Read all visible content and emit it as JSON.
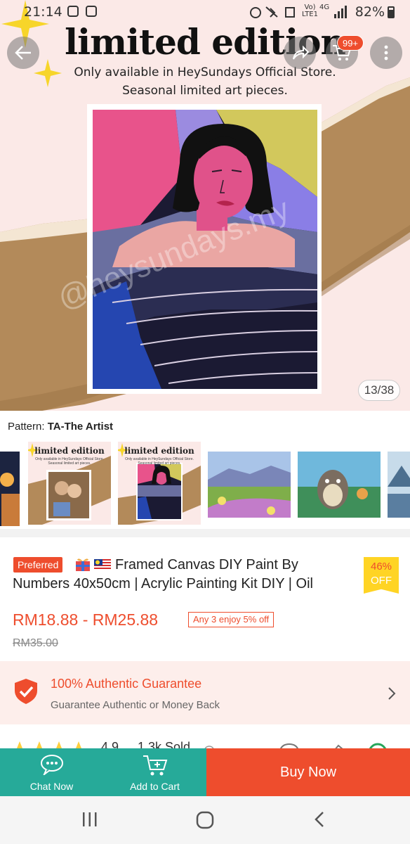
{
  "status_bar": {
    "time": "21:14",
    "network_label_top": "Vo)",
    "network_label_bottom": "LTE1",
    "network_type": "4G",
    "battery": "82%"
  },
  "hero": {
    "title": "limited edition",
    "subtitle_line1": "Only available in HeySundays Official Store.",
    "subtitle_line2": "Seasonal limited art pieces.",
    "watermark": "@heysundays.my",
    "image_counter": "13/38",
    "cart_badge": "99+"
  },
  "variation": {
    "label": "Pattern: ",
    "selected": "TA-The Artist",
    "thumbs": [
      {
        "name": "city-night",
        "title": ""
      },
      {
        "name": "limited-edition-couple",
        "title": "limited edition",
        "sub": "Only available in HeySundays Official Store. Seasonal limited art pieces."
      },
      {
        "name": "limited-edition-the-artist",
        "title": "limited edition",
        "sub": "Only available in HeySundays Official Store. Seasonal limited art pieces."
      },
      {
        "name": "flower-field",
        "title": ""
      },
      {
        "name": "totoro",
        "title": ""
      },
      {
        "name": "snow-mountain",
        "title": ""
      }
    ]
  },
  "product": {
    "preferred_badge": "Preferred",
    "title": "Framed Canvas DIY Paint By Numbers 40x50cm | Acrylic Painting Kit DIY | Oil",
    "discount_percent": "46%",
    "discount_off": "OFF",
    "price_range": "RM18.88 - RM25.88",
    "promo": "Any 3 enjoy 5% off",
    "original_price": "RM35.00"
  },
  "guarantee": {
    "title": "100% Authentic Guarantee",
    "subtitle": "Guarantee Authentic or Money Back"
  },
  "rating": {
    "score": "4.9",
    "sold": "1.3k Sold"
  },
  "bottom_bar": {
    "chat_label": "Chat Now",
    "cart_label": "Add to Cart",
    "buy_label": "Buy Now"
  },
  "colors": {
    "brand": "#ee4d2d",
    "teal": "#26aa99",
    "discount_bg": "#ffd424"
  }
}
